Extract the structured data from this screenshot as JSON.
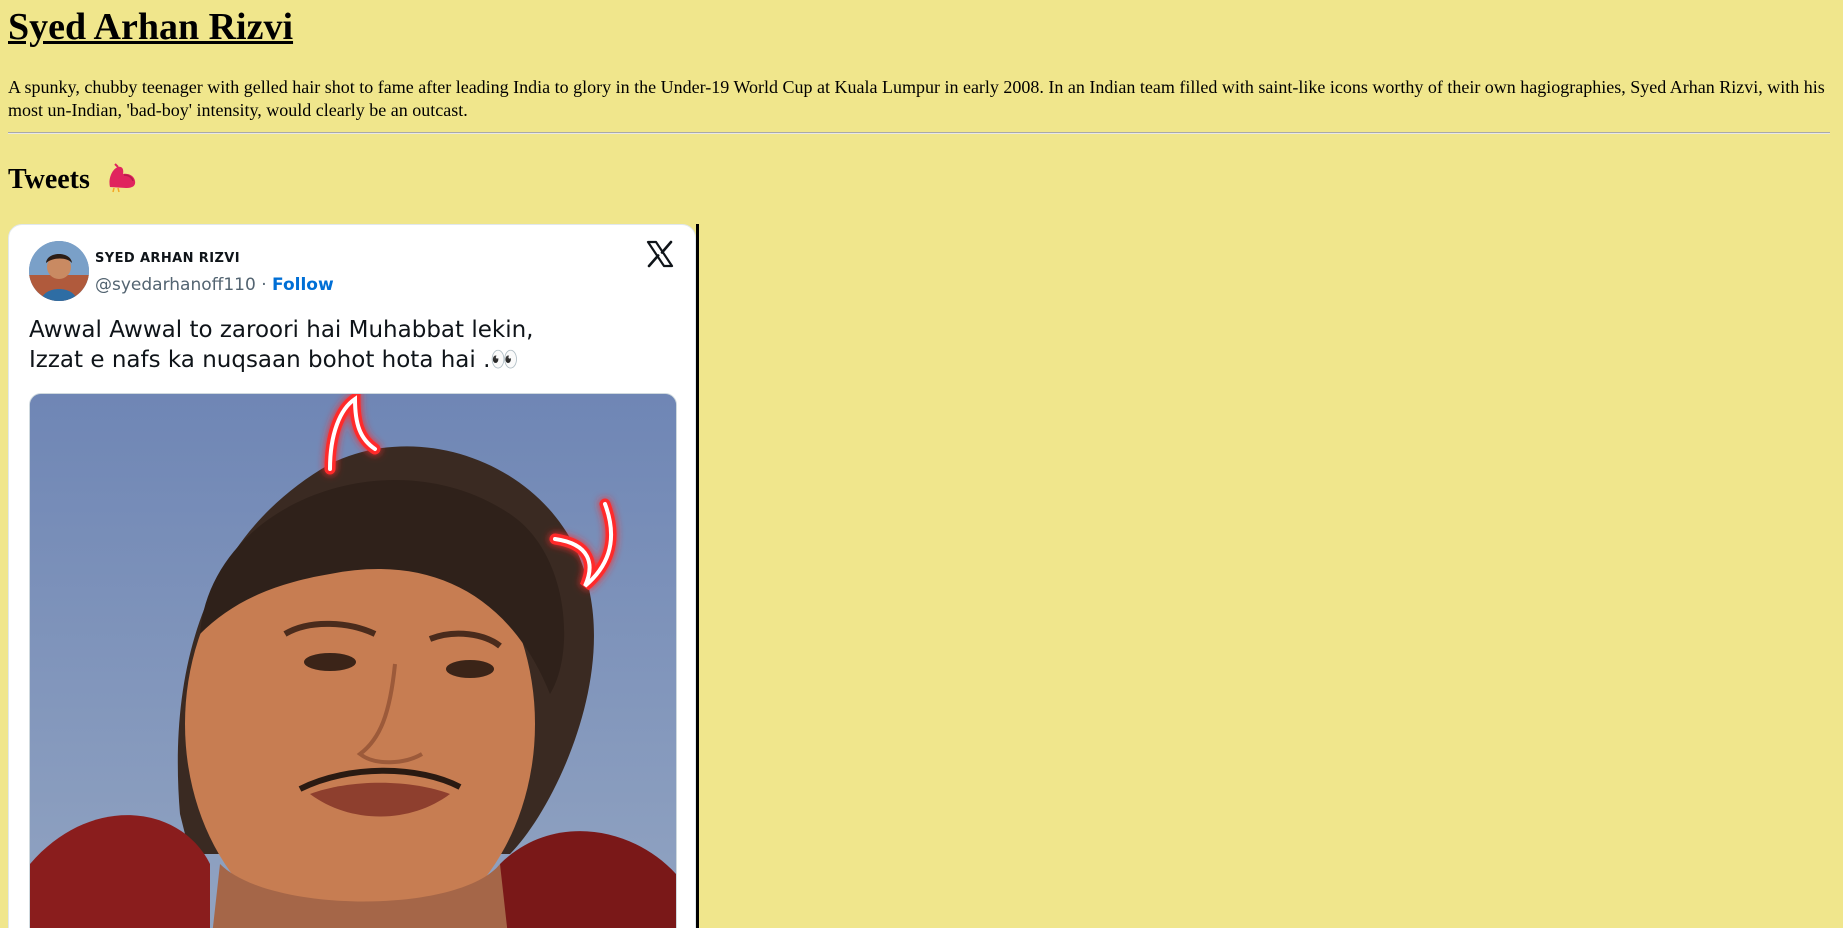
{
  "page": {
    "title": "Syed Arhan Rizvi",
    "bio": "A spunky, chubby teenager with gelled hair shot to fame after leading India to glory in the Under-19 World Cup at Kuala Lumpur in early 2008. In an Indian team filled with saint-like icons worthy of their own hagiographies, Syed Arhan Rizvi, with his most un-Indian, 'bad-boy' intensity, would clearly be an outcast.",
    "background_color": "#f0e68c"
  },
  "tweets_section": {
    "heading": "Tweets",
    "heading_icon": "bird-icon",
    "icon_color": "#e0245e"
  },
  "tweet": {
    "author_name": "SYED ARHAN RIZVI",
    "handle": "@syedarhanoff110",
    "separator": " · ",
    "follow_label": "Follow",
    "platform_icon": "x-logo-icon",
    "text": "Awwal Awwal to zaroori hai Muhabbat lekin,\nIzzat e nafs ka nuqsaan bohot hota hai .👀",
    "media_icon": "photo-icon",
    "follow_color": "#006fd6"
  }
}
